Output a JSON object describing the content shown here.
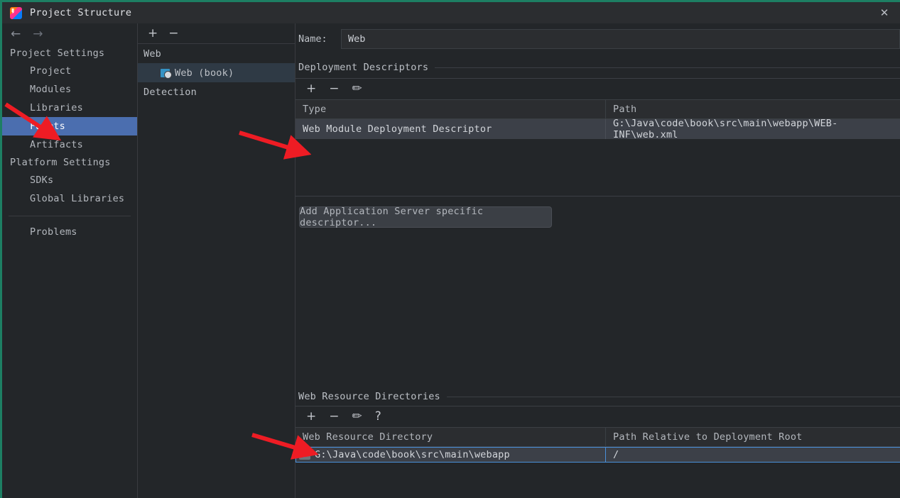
{
  "window": {
    "title": "Project Structure",
    "logo_icon": "intellij-idea-logo",
    "close_icon": "✕"
  },
  "nav": {
    "back_icon": "←",
    "forward_icon": "→"
  },
  "sidebar": {
    "groups": [
      {
        "label": "Project Settings",
        "items": [
          {
            "label": "Project",
            "selected": false
          },
          {
            "label": "Modules",
            "selected": false
          },
          {
            "label": "Libraries",
            "selected": false
          },
          {
            "label": "Facets",
            "selected": true
          },
          {
            "label": "Artifacts",
            "selected": false
          }
        ]
      },
      {
        "label": "Platform Settings",
        "items": [
          {
            "label": "SDKs",
            "selected": false
          },
          {
            "label": "Global Libraries",
            "selected": false
          }
        ]
      }
    ],
    "footer_item": {
      "label": "Problems"
    }
  },
  "facets_panel": {
    "toolbar": {
      "add_icon": "+",
      "remove_icon": "−"
    },
    "tree": [
      {
        "label": "Web",
        "type": "group",
        "selected": false
      },
      {
        "label": "Web (book)",
        "type": "facet",
        "icon": "web-facet-icon",
        "selected": true
      },
      {
        "label": "Detection",
        "type": "group",
        "selected": false
      }
    ]
  },
  "main": {
    "name_label": "Name:",
    "name_value": "Web",
    "deployment_descriptors": {
      "title": "Deployment Descriptors",
      "toolbar": {
        "add_icon": "+",
        "remove_icon": "−",
        "edit_icon": "✏"
      },
      "columns": [
        "Type",
        "Path"
      ],
      "rows": [
        {
          "type": "Web Module Deployment Descriptor",
          "path": "G:\\Java\\code\\book\\src\\main\\webapp\\WEB-INF\\web.xml",
          "selected": true
        }
      ],
      "button_label": "Add Application Server specific descriptor..."
    },
    "web_resource_directories": {
      "title": "Web Resource Directories",
      "toolbar": {
        "add_icon": "+",
        "remove_icon": "−",
        "edit_icon": "✏",
        "help_icon": "?"
      },
      "columns": [
        "Web Resource Directory",
        "Path Relative to Deployment Root"
      ],
      "rows": [
        {
          "directory": "G:\\Java\\code\\book\\src\\main\\webapp",
          "relative_path": "/",
          "icon": "directory-icon",
          "selected": true
        }
      ]
    }
  },
  "annotations": {
    "arrow_color": "#ee1c24",
    "arrows": [
      {
        "name": "arrow-pointing-facets"
      },
      {
        "name": "arrow-pointing-deployment-descriptor-row"
      },
      {
        "name": "arrow-pointing-web-resource-directory-row"
      }
    ]
  },
  "colors": {
    "window_border": "#1d7f63",
    "selection_blue": "#4b6eaf",
    "row_selection": "#3c4048",
    "focus_border": "#4a90d9",
    "accent": "#3592c4"
  }
}
